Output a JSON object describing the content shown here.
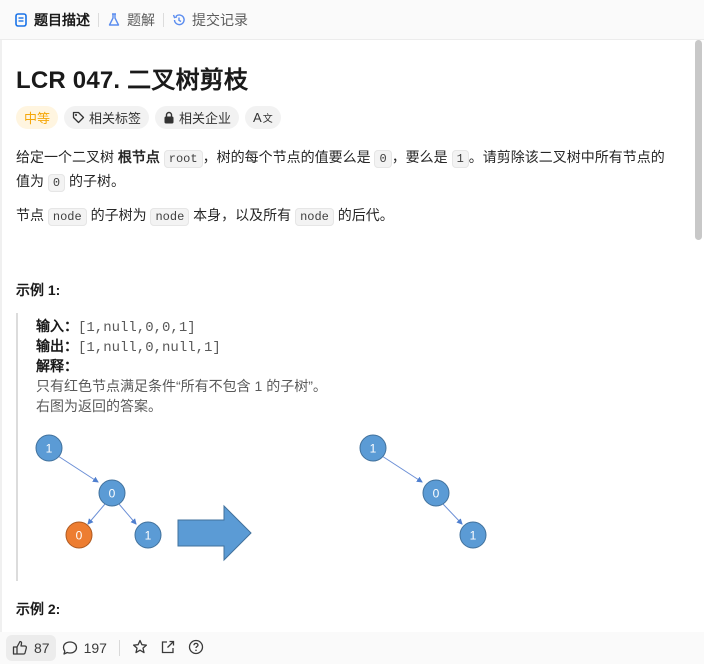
{
  "tabs": [
    {
      "label": "题目描述",
      "icon": "description-icon"
    },
    {
      "label": "题解",
      "icon": "flask-icon"
    },
    {
      "label": "提交记录",
      "icon": "history-icon"
    }
  ],
  "problem": {
    "title": "LCR 047. 二叉树剪枝",
    "tags": {
      "difficulty": "中等",
      "related_tags": "相关标签",
      "related_companies": "相关企业",
      "translate": "A"
    },
    "desc1": {
      "p1": "给定一个二叉树 ",
      "b1": "根节点",
      "c1": "root",
      "p2": "，树的每个节点的值要么是 ",
      "c2": "0",
      "p3": "，要么是 ",
      "c3": "1",
      "p4": "。请剪除该二叉树中所有节点的值为 ",
      "c4": "0",
      "p5": " 的子树。"
    },
    "desc2": {
      "p1": "节点 ",
      "c1": "node",
      "p2": " 的子树为 ",
      "c2": "node",
      "p3": " 本身，以及所有 ",
      "c3": "node",
      "p4": " 的后代。"
    },
    "example1": {
      "heading": "示例 1:",
      "input_label": "输入：",
      "input_value": "[1,null,0,0,1]",
      "output_label": "输出：",
      "output_value": "[1,null,0,null,1]",
      "explain_label": "解释：",
      "explain_line1": "只有红色节点满足条件“所有不包含 1 的子树”。",
      "explain_line2": "右图为返回的答案。"
    },
    "example2_heading": "示例 2:",
    "figure": {
      "left_tree": [
        "1",
        "0",
        "0",
        "1"
      ],
      "right_tree": [
        "1",
        "0",
        "1"
      ],
      "colors": {
        "node_blue": "#5b9bd5",
        "node_red": "#ed7d31",
        "arrow": "#4f8fcf"
      }
    }
  },
  "bottom": {
    "likes": "87",
    "comments": "197"
  }
}
